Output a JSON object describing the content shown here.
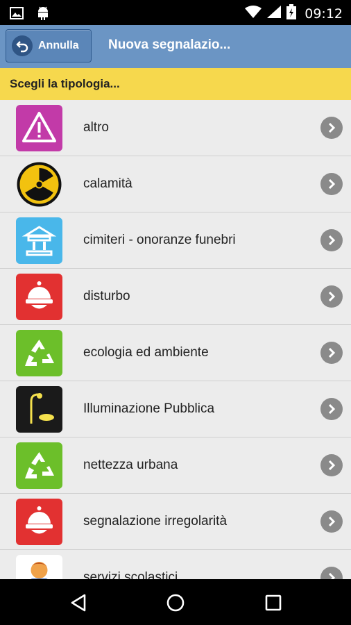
{
  "statusbar": {
    "time": "09:12",
    "icons": [
      "image-icon",
      "android-debug-icon",
      "wifi-icon",
      "signal-icon",
      "battery-icon"
    ]
  },
  "appbar": {
    "back_label": "Annulla",
    "title": "Nuova segnalazio..."
  },
  "subheader": {
    "text": "Scegli la tipologia..."
  },
  "list": {
    "items": [
      {
        "label": "altro",
        "icon": "warning-icon",
        "color": "#c23aa8"
      },
      {
        "label": "calamità",
        "icon": "radiation-icon",
        "color": "#f2c20f"
      },
      {
        "label": "cimiteri - onoranze funebri",
        "icon": "temple-icon",
        "color": "#49b7ea"
      },
      {
        "label": "disturbo",
        "icon": "police-helmet-icon",
        "color": "#e23131"
      },
      {
        "label": "ecologia ed ambiente",
        "icon": "recycle-icon",
        "color": "#6cbf2a"
      },
      {
        "label": "Illuminazione Pubblica",
        "icon": "street-lamp-icon",
        "color": "#1a1a1a"
      },
      {
        "label": "nettezza urbana",
        "icon": "recycle-icon",
        "color": "#6cbf2a"
      },
      {
        "label": "segnalazione irregolarità",
        "icon": "police-helmet-icon",
        "color": "#e23131"
      },
      {
        "label": "servizi scolastici",
        "icon": "school-child-icon",
        "color": "#f0a24a"
      }
    ]
  },
  "navbar": {
    "buttons": [
      "back-nav-icon",
      "home-nav-icon",
      "recents-nav-icon"
    ]
  }
}
